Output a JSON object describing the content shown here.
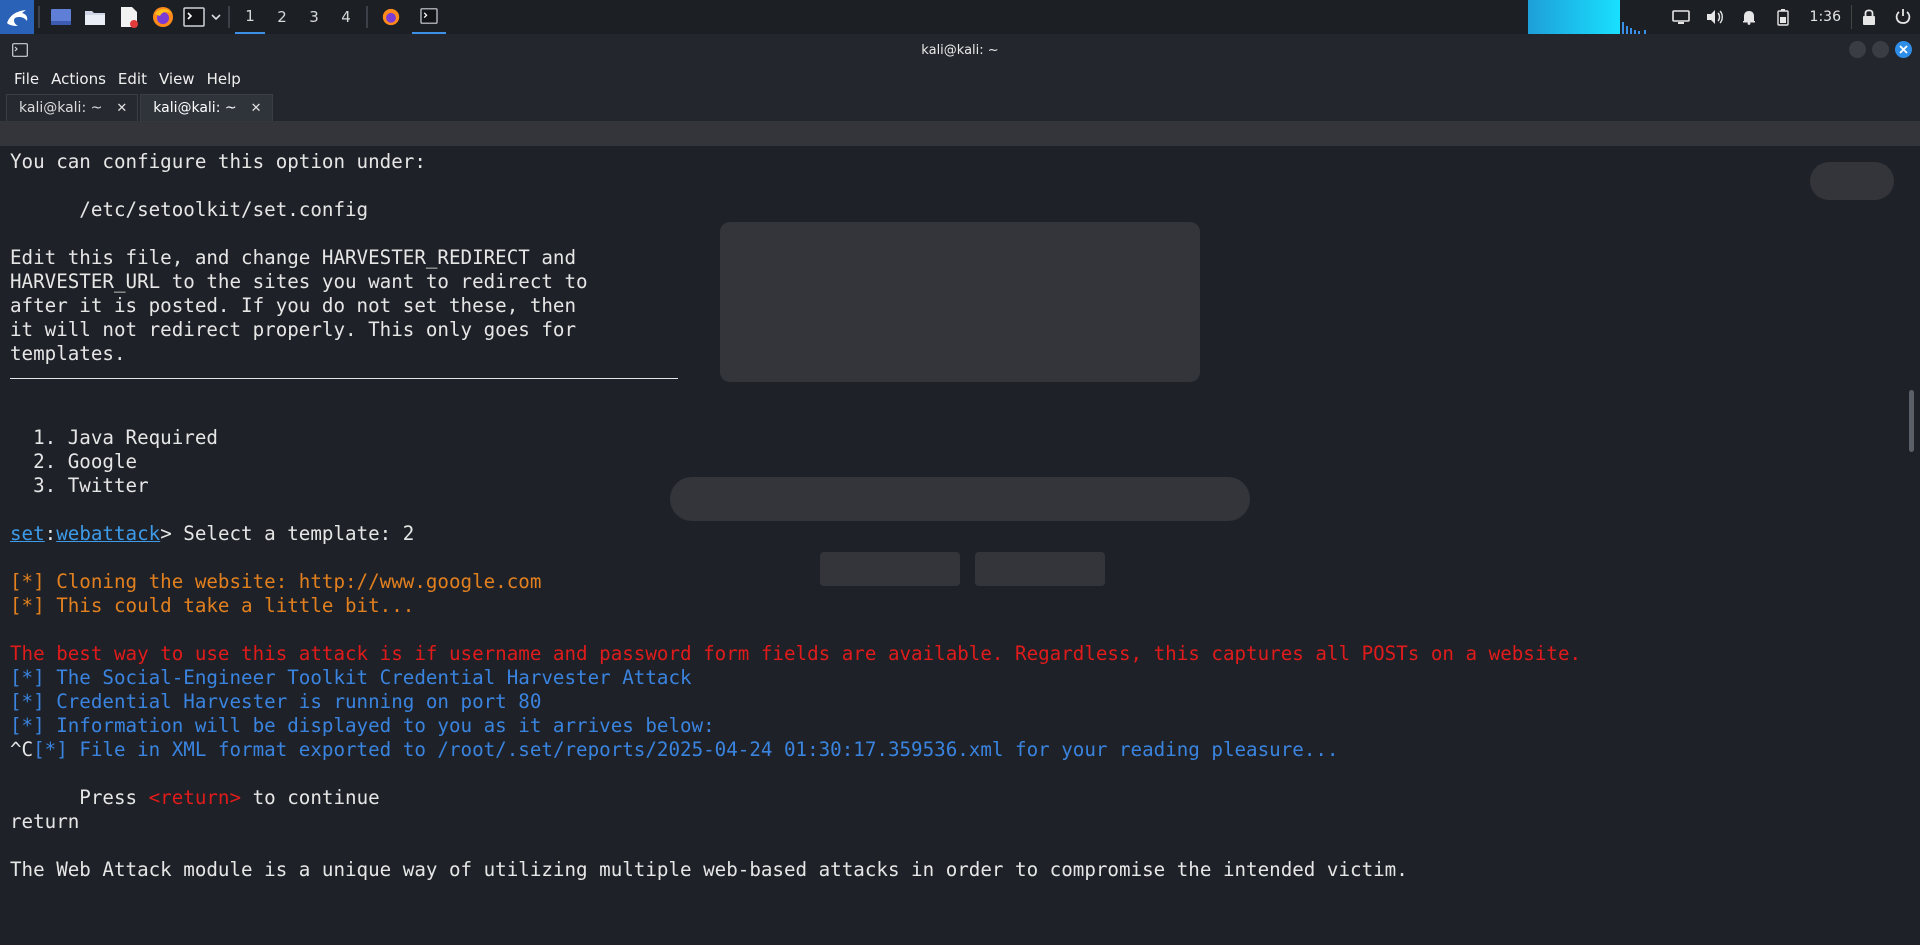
{
  "panel": {
    "workspaces": [
      "1",
      "2",
      "3",
      "4"
    ],
    "active_workspace": "1",
    "clock": "1:36"
  },
  "window": {
    "title": "kali@kali: ~",
    "menu": [
      "File",
      "Actions",
      "Edit",
      "View",
      "Help"
    ],
    "tabs": [
      {
        "label": "kali@kali: ~",
        "close": "✕"
      },
      {
        "label": "kali@kali: ~",
        "close": "✕"
      }
    ]
  },
  "terminal": {
    "config_intro": "You can configure this option under:",
    "config_path": "      /etc/setoolkit/set.config",
    "edit_1": "Edit this file, and change HARVESTER_REDIRECT and",
    "edit_2": "HARVESTER_URL to the sites you want to redirect to",
    "edit_3": "after it is posted. If you do not set these, then",
    "edit_4": "it will not redirect properly. This only goes for",
    "edit_5": "templates.",
    "opt_1": "  1. Java Required",
    "opt_2": "  2. Google",
    "opt_3": "  3. Twitter",
    "prompt_set": "set",
    "prompt_colon": ":",
    "prompt_module": "webattack",
    "prompt_text": "> Select a template: 2",
    "cloning": "[*] Cloning the website: http://www.google.com",
    "could_take": "[*] This could take a little bit...",
    "best_way": "The best way to use this attack is if username and password form fields are available. Regardless, this captures all POSTs on a website.",
    "set_attack": "[*] The Social-Engineer Toolkit Credential Harvester Attack",
    "running": "[*] Credential Harvester is running on port 80",
    "info": "[*] Information will be displayed to you as it arrives below:",
    "ctrl_c": "^C",
    "exported": "[*] File in XML format exported to /root/.set/reports/2025-04-24 01:30:17.359536.xml for your reading pleasure...",
    "press": "      Press ",
    "return_tag": "<return>",
    "to_continue": " to continue",
    "return_typed": "return",
    "web_attack": "The Web Attack module is a unique way of utilizing multiple web-based attacks in order to compromise the intended victim."
  },
  "colors": {
    "accent": "#3d8fe8",
    "orange": "#e2801f",
    "red": "#e01b1b",
    "blue": "#3a84e0"
  }
}
